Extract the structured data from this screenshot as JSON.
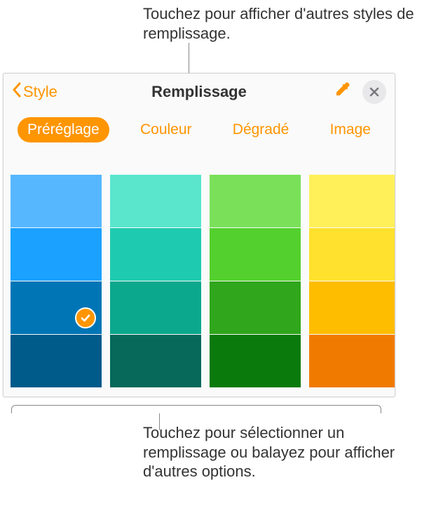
{
  "callouts": {
    "top": "Touchez pour afficher d'autres styles de remplissage.",
    "bottom": "Touchez pour sélectionner un remplissage ou balayez pour afficher d'autres options."
  },
  "header": {
    "back_label": "Style",
    "title": "Remplissage"
  },
  "tabs": {
    "items": [
      {
        "label": "Préréglage",
        "active": true
      },
      {
        "label": "Couleur",
        "active": false
      },
      {
        "label": "Dégradé",
        "active": false
      },
      {
        "label": "Image",
        "active": false
      }
    ]
  },
  "swatches": {
    "selected": {
      "col": 0,
      "row": 2
    },
    "columns": [
      [
        "#56b7ff",
        "#1ba1ff",
        "#0075b6",
        "#005a8a"
      ],
      [
        "#5ae6cd",
        "#1fcbb0",
        "#0ca88d",
        "#06695a"
      ],
      [
        "#7ae05a",
        "#54d02e",
        "#2fa61b",
        "#0a7a0d"
      ],
      [
        "#fff05a",
        "#ffe12e",
        "#ffbd00",
        "#f07a00"
      ],
      [
        "#ff6a5a",
        "#ff4a3a",
        "#e8241b",
        "#b81109"
      ]
    ]
  },
  "icons": {
    "back_chevron": "chevron-left-icon",
    "eyedropper": "eyedropper-icon",
    "close": "close-icon",
    "check": "check-icon"
  }
}
